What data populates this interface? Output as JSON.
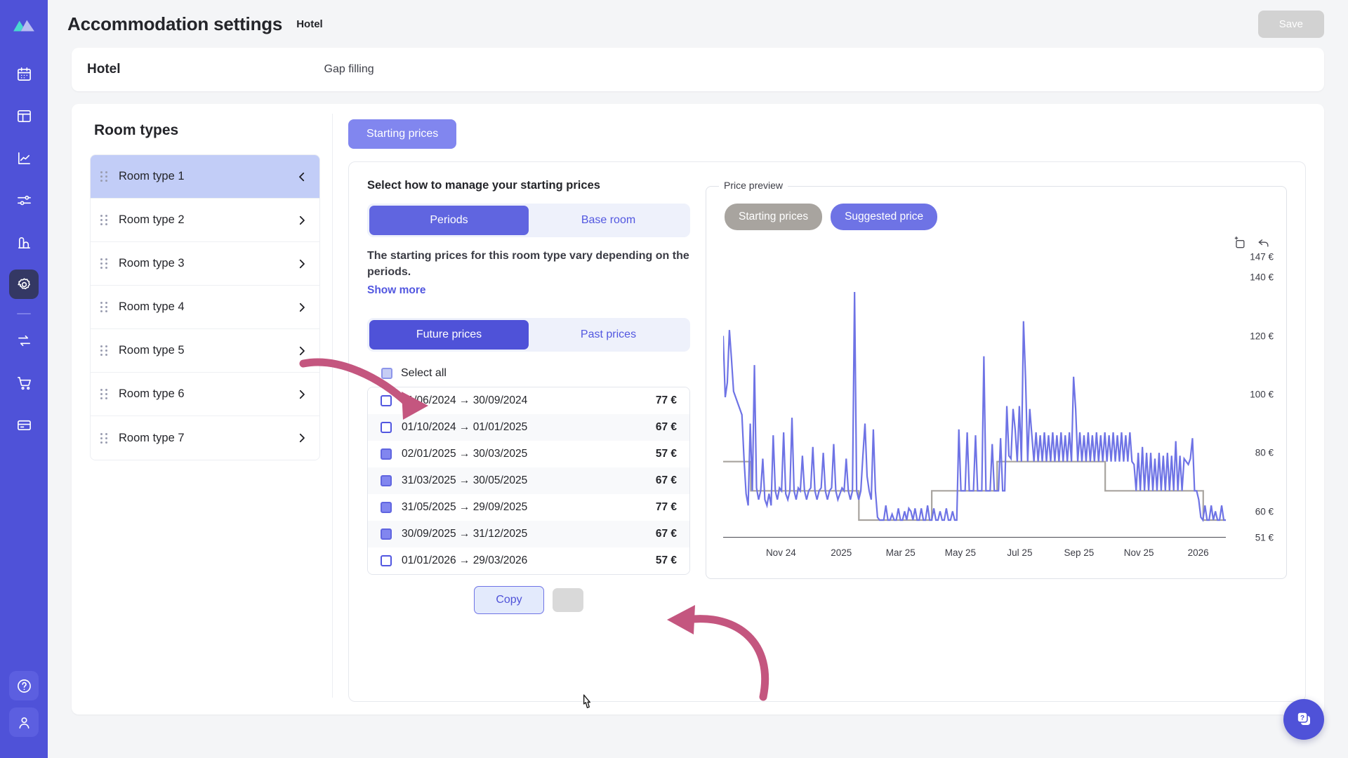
{
  "rail": {
    "logo": "mountain-logo",
    "items": [
      {
        "name": "calendar",
        "active": false
      },
      {
        "name": "dashboard",
        "active": false
      },
      {
        "name": "analytics",
        "active": false
      },
      {
        "name": "sliders",
        "active": false
      },
      {
        "name": "insights",
        "active": false
      },
      {
        "name": "settings",
        "active": true
      },
      {
        "name": "sync",
        "active": false
      },
      {
        "name": "cart",
        "active": false
      },
      {
        "name": "billing",
        "active": false
      }
    ],
    "bottom": [
      {
        "name": "help",
        "active": false
      },
      {
        "name": "account",
        "active": false
      }
    ]
  },
  "header": {
    "title": "Accommodation settings",
    "subtitle": "Hotel",
    "save_label": "Save"
  },
  "hotel_card": {
    "name": "Hotel",
    "strategy": "Gap filling"
  },
  "room_types": {
    "title": "Room types",
    "items": [
      {
        "label": "Room type 1",
        "active": true
      },
      {
        "label": "Room type 2",
        "active": false
      },
      {
        "label": "Room type 3",
        "active": false
      },
      {
        "label": "Room type 4",
        "active": false
      },
      {
        "label": "Room type 5",
        "active": false
      },
      {
        "label": "Room type 6",
        "active": false
      },
      {
        "label": "Room type 7",
        "active": false
      }
    ]
  },
  "tabs": {
    "starting_prices": "Starting prices"
  },
  "manage": {
    "heading": "Select how to manage your starting prices",
    "mode_options": [
      "Periods",
      "Base room"
    ],
    "mode_selected": "Periods",
    "description": "The starting prices for this room type vary depending on the periods.",
    "show_more": "Show more"
  },
  "price_table": {
    "range_options": [
      "Future prices",
      "Past prices"
    ],
    "range_selected": "Future prices",
    "select_all_label": "Select all",
    "select_all_state": "partial",
    "rows": [
      {
        "range": "01/06/2024 → 30/09/2024",
        "price": "77 €",
        "checked": false
      },
      {
        "range": "01/10/2024 → 01/01/2025",
        "price": "67 €",
        "checked": false
      },
      {
        "range": "02/01/2025 → 30/03/2025",
        "price": "57 €",
        "checked": true
      },
      {
        "range": "31/03/2025 → 30/05/2025",
        "price": "67 €",
        "checked": true
      },
      {
        "range": "31/05/2025 → 29/09/2025",
        "price": "77 €",
        "checked": true
      },
      {
        "range": "30/09/2025 → 31/12/2025",
        "price": "67 €",
        "checked": true
      },
      {
        "range": "01/01/2026 → 29/03/2026",
        "price": "57 €",
        "checked": false
      }
    ],
    "copy_label": "Copy"
  },
  "preview": {
    "caption": "Price preview",
    "chips": [
      {
        "label": "Starting prices",
        "color": "#a8a49f",
        "active": false
      },
      {
        "label": "Suggested price",
        "color": "#6e73e5",
        "active": true
      }
    ],
    "tools": [
      "add-square-icon",
      "undo-icon"
    ]
  },
  "chart_data": {
    "type": "line",
    "title": "Price preview",
    "xlabel": "",
    "ylabel": "",
    "grid": false,
    "legend_position": "top-left",
    "ylim": [
      51,
      147
    ],
    "ytick_labels": [
      "147 €",
      "140 €",
      "120 €",
      "100 €",
      "80 €",
      "60 €",
      "51 €"
    ],
    "ytick_values": [
      147,
      140,
      120,
      100,
      80,
      60,
      51
    ],
    "xtick_labels": [
      "Nov 24",
      "2025",
      "Mar 25",
      "May 25",
      "Jul 25",
      "Sep 25",
      "Nov 25",
      "2026"
    ],
    "xtick_positions": [
      0.115,
      0.235,
      0.353,
      0.472,
      0.59,
      0.708,
      0.827,
      0.945
    ],
    "series": [
      {
        "name": "Starting prices",
        "color": "#a8a49f",
        "style": "step",
        "points": [
          [
            0.0,
            77
          ],
          [
            0.055,
            77
          ],
          [
            0.055,
            67
          ],
          [
            0.27,
            67
          ],
          [
            0.27,
            57
          ],
          [
            0.415,
            57
          ],
          [
            0.415,
            67
          ],
          [
            0.545,
            67
          ],
          [
            0.545,
            77
          ],
          [
            0.76,
            77
          ],
          [
            0.76,
            67
          ],
          [
            0.955,
            67
          ],
          [
            0.955,
            57
          ],
          [
            1.0,
            57
          ]
        ]
      },
      {
        "name": "Suggested price",
        "color": "#6e73e5",
        "style": "line",
        "values": [
          120,
          99,
          104,
          122,
          112,
          101,
          99,
          97,
          95,
          93,
          78,
          66,
          62,
          90,
          67,
          110,
          68,
          64,
          67,
          78,
          64,
          62,
          66,
          62,
          86,
          67,
          64,
          68,
          67,
          87,
          66,
          64,
          67,
          92,
          67,
          64,
          68,
          67,
          79,
          67,
          64,
          67,
          68,
          82,
          67,
          64,
          67,
          68,
          80,
          67,
          64,
          67,
          68,
          83,
          67,
          64,
          66,
          68,
          67,
          78,
          67,
          64,
          67,
          135,
          67,
          64,
          67,
          79,
          90,
          72,
          67,
          64,
          88,
          67,
          58,
          57,
          57,
          57,
          62,
          57,
          57,
          59,
          57,
          57,
          61,
          57,
          57,
          60,
          57,
          61,
          60,
          57,
          61,
          57,
          57,
          61,
          57,
          57,
          62,
          57,
          57,
          61,
          57,
          57,
          60,
          57,
          57,
          61,
          57,
          57,
          60,
          57,
          57,
          88,
          67,
          67,
          67,
          87,
          67,
          67,
          67,
          86,
          67,
          67,
          67,
          113,
          67,
          67,
          67,
          83,
          67,
          67,
          67,
          85,
          67,
          67,
          96,
          79,
          78,
          95,
          88,
          77,
          96,
          77,
          125,
          105,
          77,
          95,
          86,
          77,
          87,
          77,
          86,
          77,
          87,
          77,
          86,
          77,
          87,
          77,
          86,
          77,
          87,
          77,
          86,
          77,
          87,
          77,
          106,
          95,
          77,
          87,
          77,
          86,
          77,
          87,
          77,
          86,
          77,
          87,
          77,
          86,
          77,
          87,
          77,
          86,
          77,
          87,
          77,
          86,
          77,
          87,
          77,
          86,
          77,
          87,
          77,
          76,
          67,
          80,
          67,
          82,
          67,
          80,
          67,
          80,
          67,
          78,
          67,
          80,
          67,
          79,
          67,
          80,
          67,
          79,
          67,
          84,
          67,
          79,
          67,
          78,
          77,
          76,
          78,
          85,
          67,
          67,
          64,
          58,
          57,
          62,
          57,
          57,
          62,
          57,
          60,
          57,
          57,
          62,
          57,
          57
        ]
      }
    ]
  },
  "help_fab": {
    "name": "help-chat-icon"
  },
  "annotations": [
    {
      "name": "arrow-to-period-row",
      "color": "#c4567f"
    },
    {
      "name": "arrow-to-copy-button",
      "color": "#c4567f"
    }
  ]
}
